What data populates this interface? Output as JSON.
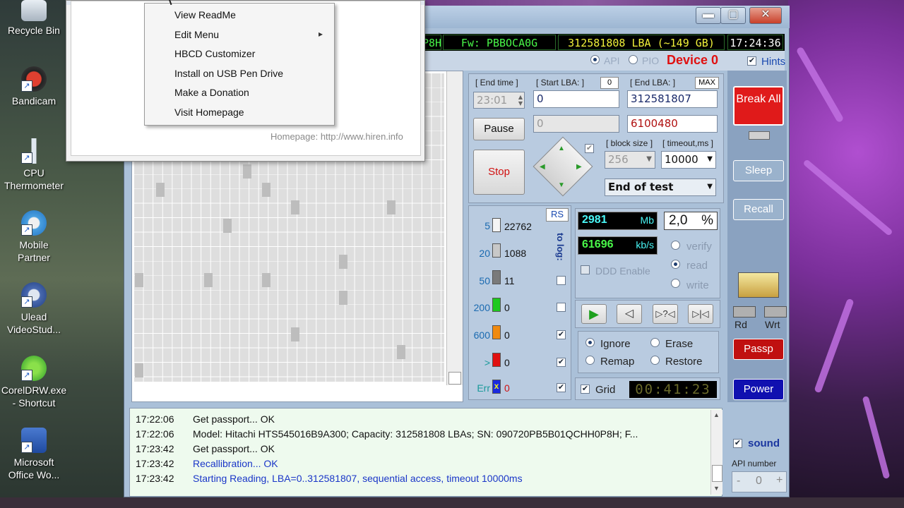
{
  "desktop": {
    "icons": [
      {
        "label": "Recycle Bin"
      },
      {
        "label": "Bandicam"
      },
      {
        "label": "CPU Thermometer"
      },
      {
        "label": "Mobile Partner"
      },
      {
        "label": "Ulead VideoStud..."
      },
      {
        "label": "CorelDRW.exe - Shortcut"
      },
      {
        "label": "Microsoft Office Wo..."
      }
    ]
  },
  "window": {
    "controls": {
      "minimize": "▬",
      "maximize": "▢",
      "close": "✕"
    }
  },
  "status": {
    "serial_tail": "P8H",
    "firmware": "Fw: PBBOCA0G",
    "lba": "312581808 LBA (~149 GB)",
    "clock": "17:24:36"
  },
  "mode": {
    "api": "API",
    "pio": "PIO",
    "device": "Device 0",
    "hints": "Hints"
  },
  "scan": {
    "end_time_label": "[ End time ]",
    "end_time_value": "23:01",
    "start_lba_label": "[ Start LBA: ]",
    "start_lba_zero": "0",
    "start_lba_value": "0",
    "current_lba": "0",
    "end_lba_label": "[ End LBA: ]",
    "end_lba_max": "MAX",
    "end_lba_value": "312581807",
    "remaining_value": "6100480",
    "pause": "Pause",
    "stop": "Stop",
    "block_size_label": "[ block size ]",
    "block_size_value": "256",
    "timeout_label": "[ timeout,ms ]",
    "timeout_value": "10000",
    "end_action": "End of test"
  },
  "counts": {
    "rs": "RS",
    "to_log": "to log:",
    "rows": [
      {
        "threshold": "5",
        "count": "22762"
      },
      {
        "threshold": "20",
        "count": "1088"
      },
      {
        "threshold": "50",
        "count": "11"
      },
      {
        "threshold": "200",
        "count": "0"
      },
      {
        "threshold": "600",
        "count": "0"
      },
      {
        "threshold": ">",
        "count": "0"
      },
      {
        "threshold": "Err",
        "count": "0"
      }
    ]
  },
  "stats": {
    "mb_value": "2981",
    "mb_unit": "Mb",
    "percent_value": "2,0",
    "percent_unit": "%",
    "speed_value": "61696",
    "speed_unit": "kb/s",
    "verify": "verify",
    "read": "read",
    "write": "write",
    "ddd": "DDD Enable",
    "ignore": "Ignore",
    "erase": "Erase",
    "remap": "Remap",
    "restore": "Restore",
    "grid": "Grid",
    "elapsed": "00:41:23"
  },
  "side": {
    "break_all": "Break All",
    "sleep": "Sleep",
    "recall": "Recall",
    "rd": "Rd",
    "wrt": "Wrt",
    "passp": "Passp",
    "power": "Power",
    "sound": "sound",
    "api_number": "API number",
    "api_minus": "-",
    "api_value": "0",
    "api_plus": "+"
  },
  "log": [
    {
      "time": "17:22:06",
      "msg": "Get passport... OK",
      "blue": false
    },
    {
      "time": "17:22:06",
      "msg": "Model: Hitachi HTS545016B9A300; Capacity: 312581808 LBAs; SN: 090720PB5B01QCHH0P8H; F...",
      "blue": false
    },
    {
      "time": "17:23:42",
      "msg": "Get passport... OK",
      "blue": false
    },
    {
      "time": "17:23:42",
      "msg": "Recallibration... OK",
      "blue": true
    },
    {
      "time": "17:23:42",
      "msg": "Starting Reading, LBA=0..312581807, sequential access, timeout 10000ms",
      "blue": true
    }
  ],
  "popup": {
    "homepage": "Homepage: http://www.hiren.info",
    "menu": [
      {
        "label": "View ReadMe"
      },
      {
        "label": "Edit Menu",
        "submenu": "▸"
      },
      {
        "label": "HBCD Customizer"
      },
      {
        "label": "Install on USB Pen Drive"
      },
      {
        "label": "Make a Donation"
      },
      {
        "label": "Visit Homepage"
      }
    ]
  }
}
